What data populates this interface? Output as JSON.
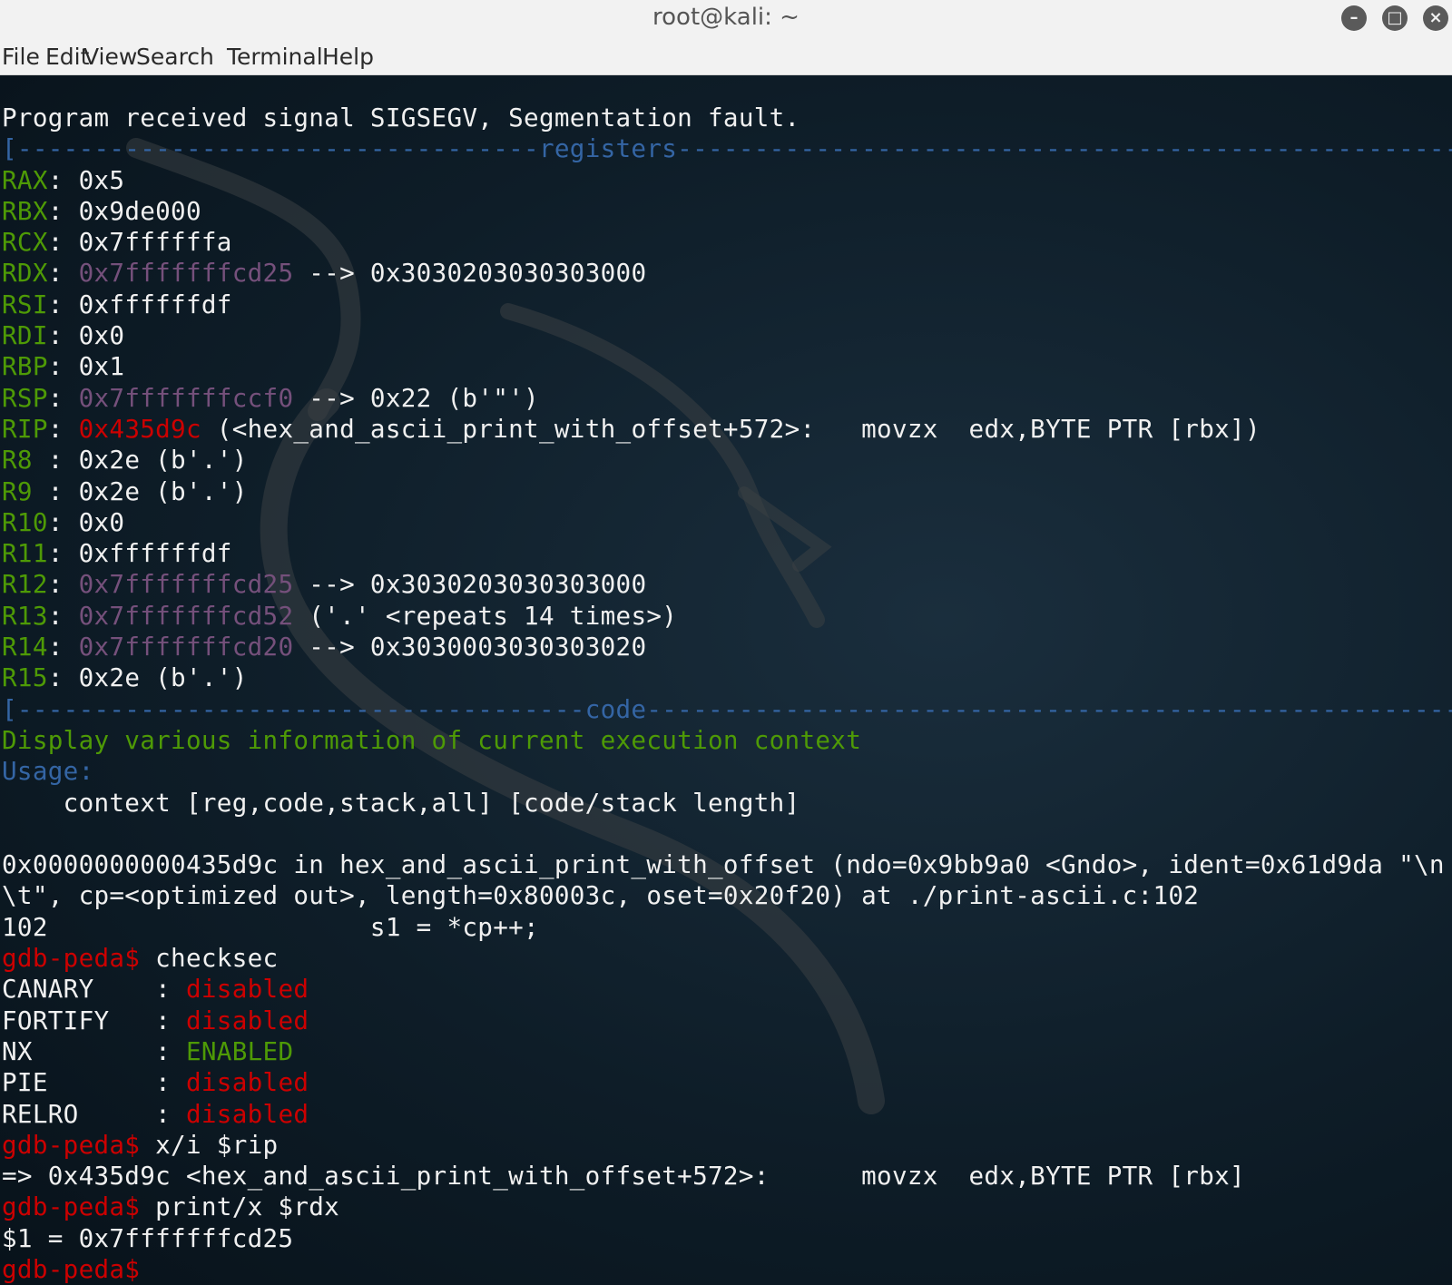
{
  "window": {
    "title": "root@kali: ~"
  },
  "menu": [
    "File",
    "Edit",
    "View",
    "Search",
    "Terminal",
    "Help"
  ],
  "terminal": {
    "signal_line": "Program received signal SIGSEGV, Segmentation fault.",
    "registers_header": {
      "left": "[----------------------------------",
      "label": "registers",
      "right": "-------------------------------------------------------]"
    },
    "registers": [
      {
        "name": "RAX",
        "value": "0x5",
        "addr": "",
        "rest": ""
      },
      {
        "name": "RBX",
        "value": "0x9de000",
        "addr": "",
        "rest": ""
      },
      {
        "name": "RCX",
        "value": "0x7ffffffa",
        "addr": "",
        "rest": ""
      },
      {
        "name": "RDX",
        "value": "",
        "addr": "0x7fffffffcd25",
        "rest": " --> 0x3030203030303000"
      },
      {
        "name": "RSI",
        "value": "0xffffffdf",
        "addr": "",
        "rest": ""
      },
      {
        "name": "RDI",
        "value": "0x0",
        "addr": "",
        "rest": ""
      },
      {
        "name": "RBP",
        "value": "0x1",
        "addr": "",
        "rest": ""
      },
      {
        "name": "RSP",
        "value": "",
        "addr": "0x7fffffffccf0",
        "rest": " --> 0x22 (b'\"')"
      },
      {
        "name": "R8 ",
        "value": "0x2e (b'.')",
        "addr": "",
        "rest": ""
      },
      {
        "name": "R9 ",
        "value": "0x2e (b'.')",
        "addr": "",
        "rest": ""
      },
      {
        "name": "R10",
        "value": "0x0",
        "addr": "",
        "rest": ""
      },
      {
        "name": "R11",
        "value": "0xffffffdf",
        "addr": "",
        "rest": ""
      },
      {
        "name": "R12",
        "value": "",
        "addr": "0x7fffffffcd25",
        "rest": " --> 0x3030203030303000"
      },
      {
        "name": "R13",
        "value": "",
        "addr": "0x7fffffffcd52",
        "rest": " ('.' <repeats 14 times>)"
      },
      {
        "name": "R14",
        "value": "",
        "addr": "0x7fffffffcd20",
        "rest": " --> 0x3030003030303020"
      },
      {
        "name": "R15",
        "value": "0x2e (b'.')",
        "addr": "",
        "rest": ""
      }
    ],
    "rip": {
      "name": "RIP",
      "addr": "0x435d9c",
      "rest": " (<hex_and_ascii_print_with_offset+572>:   movzx  edx,BYTE PTR [rbx])"
    },
    "code_header": {
      "left": "[-------------------------------------",
      "label": "code",
      "right": "-------------------------------------------------------]"
    },
    "help_text": "Display various information of current execution context",
    "usage_label": "Usage:",
    "usage_line": "    context [reg,code,stack,all] [code/stack length]",
    "frame_line1": "0x0000000000435d9c in hex_and_ascii_print_with_offset (ndo=0x9bb9a0 <Gndo>, ident=0x61d9da \"\\n",
    "frame_line2": "\\t\", cp=<optimized out>, length=0x80003c, oset=0x20f20) at ./print-ascii.c:102",
    "source_line": "102                     s1 = *cp++;",
    "prompt": "gdb-peda$",
    "cmd_checksec": " checksec",
    "checksec": [
      {
        "key": "CANARY    : ",
        "value": "disabled",
        "status": "disabled"
      },
      {
        "key": "FORTIFY   : ",
        "value": "disabled",
        "status": "disabled"
      },
      {
        "key": "NX        : ",
        "value": "ENABLED",
        "status": "enabled"
      },
      {
        "key": "PIE       : ",
        "value": "disabled",
        "status": "disabled"
      },
      {
        "key": "RELRO     : ",
        "value": "disabled",
        "status": "disabled"
      }
    ],
    "cmd_xi": " x/i $rip",
    "xi_output": "=> 0x435d9c <hex_and_ascii_print_with_offset+572>:      movzx  edx,BYTE PTR [rbx]",
    "cmd_print": " print/x $rdx",
    "print_output": "$1 = 0x7fffffffcd25",
    "colors": {
      "green": "#4e9a06",
      "blue": "#3465a4",
      "purple": "#75507b",
      "red": "#cc0000",
      "text": "#f0f0f0"
    }
  }
}
